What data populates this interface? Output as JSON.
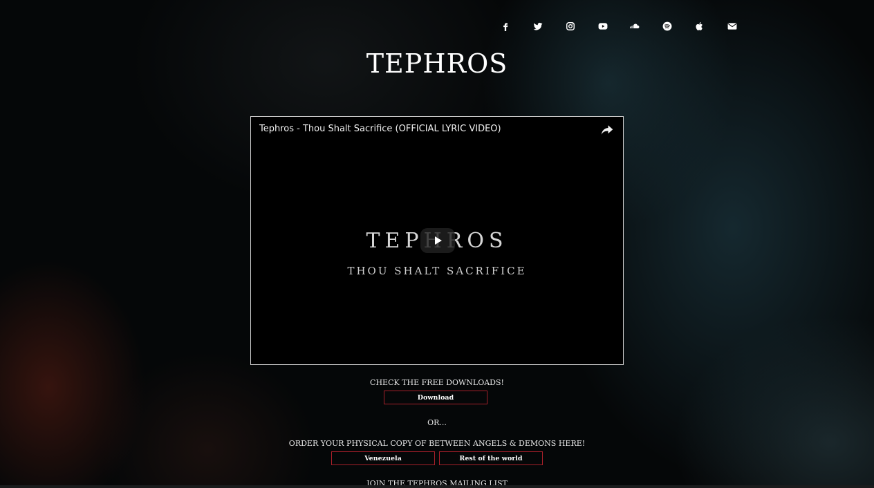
{
  "social_links": [
    {
      "name": "facebook-icon",
      "label": "Facebook"
    },
    {
      "name": "twitter-icon",
      "label": "Twitter"
    },
    {
      "name": "instagram-icon",
      "label": "Instagram"
    },
    {
      "name": "youtube-icon",
      "label": "YouTube"
    },
    {
      "name": "soundcloud-icon",
      "label": "SoundCloud"
    },
    {
      "name": "spotify-icon",
      "label": "Spotify"
    },
    {
      "name": "apple-icon",
      "label": "Apple Music"
    },
    {
      "name": "envelope-icon",
      "label": "Email"
    }
  ],
  "site": {
    "brand": "TEPHROS"
  },
  "video": {
    "title": "Tephros - Thou Shalt Sacrifice (OFFICIAL LYRIC VIDEO)",
    "thumbnail_title": "TEPHROS",
    "thumbnail_subtitle": "THOU SHALT SACRIFICE"
  },
  "downloads": {
    "caption": "CHECK THE FREE DOWNLOADS!",
    "button_label": "Download"
  },
  "separator": "OR...",
  "order": {
    "caption": "ORDER YOUR PHYSICAL COPY OF BETWEEN ANGELS & DEMONS HERE!",
    "venezuela_label": "Venezuela",
    "world_label": "Rest of the world"
  },
  "mailing": {
    "caption": "JOIN THE TEPHROS MAILING LIST"
  },
  "colors": {
    "accent_border": "#a8202a",
    "background": "#050708",
    "text": "#ffffff"
  }
}
